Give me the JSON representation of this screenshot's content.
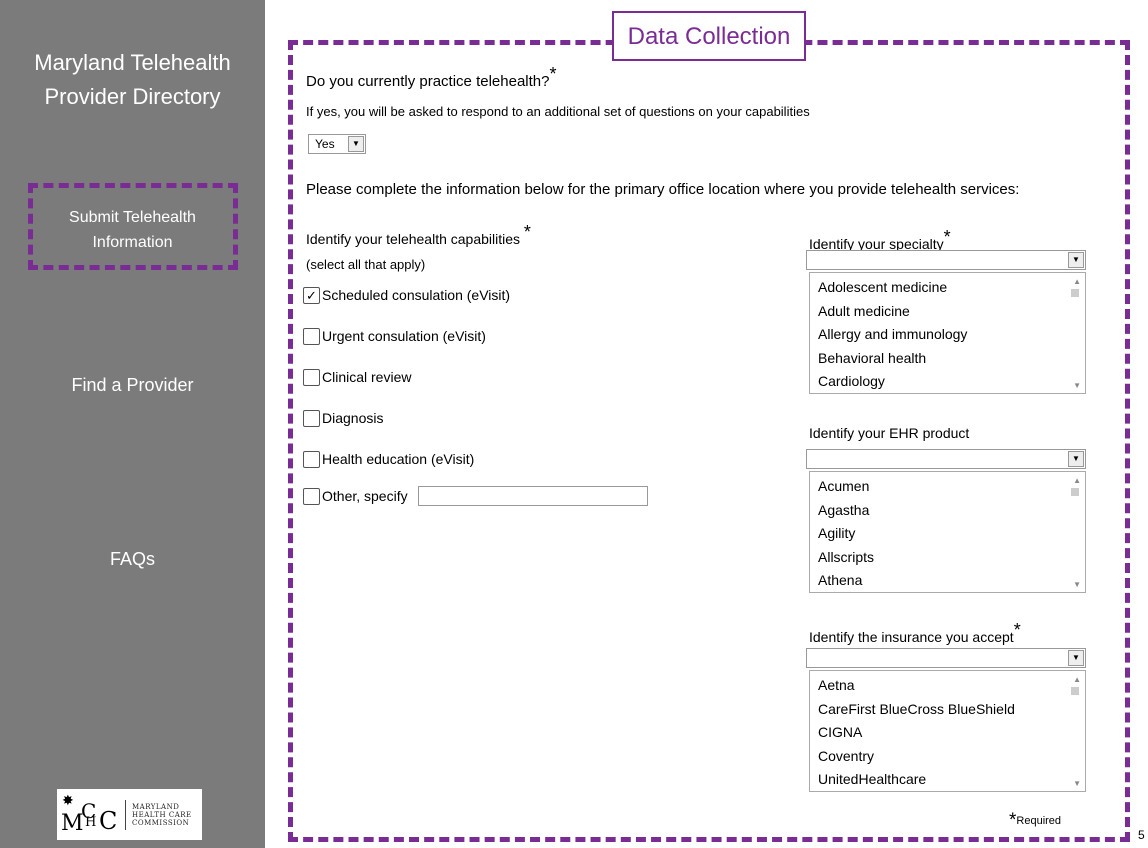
{
  "sidebar": {
    "brand_line1": "Maryland Telehealth",
    "brand_line2": "Provider Directory",
    "submit_line1": "Submit Telehealth",
    "submit_line2": "Information",
    "find": "Find a Provider",
    "faqs": "FAQs",
    "logo_text_line1": "MARYLAND",
    "logo_text_line2": "HEALTH CARE",
    "logo_text_line3": "COMMISSION",
    "logo_mark": "MHCC"
  },
  "form": {
    "title": "Data Collection",
    "q_practice": "Do you currently practice telehealth?",
    "q_practice_note": "If yes, you will be asked to respond to an additional set of questions on your capabilities",
    "practice_value": "Yes",
    "instructions": "Please complete the information below for the primary office location where you provide telehealth services:",
    "capabilities_label": "Identify your telehealth capabilities",
    "capabilities_note": "(select all that apply)",
    "capabilities": [
      {
        "label": "Scheduled consulation (eVisit)",
        "checked": true
      },
      {
        "label": "Urgent consulation (eVisit)",
        "checked": false
      },
      {
        "label": "Clinical review",
        "checked": false
      },
      {
        "label": "Diagnosis",
        "checked": false
      },
      {
        "label": "Health education (eVisit)",
        "checked": false
      },
      {
        "label": "Other, specify",
        "checked": false
      }
    ],
    "other_value": "",
    "specialty_label": "Identify your specialty",
    "specialty_options": [
      "Adolescent medicine",
      "Adult medicine",
      "Allergy and immunology",
      "Behavioral health",
      "Cardiology"
    ],
    "ehr_label": "Identify your EHR product",
    "ehr_options": [
      "Acumen",
      "Agastha",
      "Agility",
      "Allscripts",
      "Athena"
    ],
    "insurance_label": "Identify the insurance you accept",
    "insurance_options": [
      "Aetna",
      "CareFirst BlueCross BlueShield",
      "CIGNA",
      "Coventry",
      "UnitedHealthcare"
    ],
    "required_note": "Required",
    "required_mark": "*"
  },
  "page_number": "5",
  "colors": {
    "sidebar_bg": "#7b7b7b",
    "accent_purple": "#7a2c95"
  }
}
